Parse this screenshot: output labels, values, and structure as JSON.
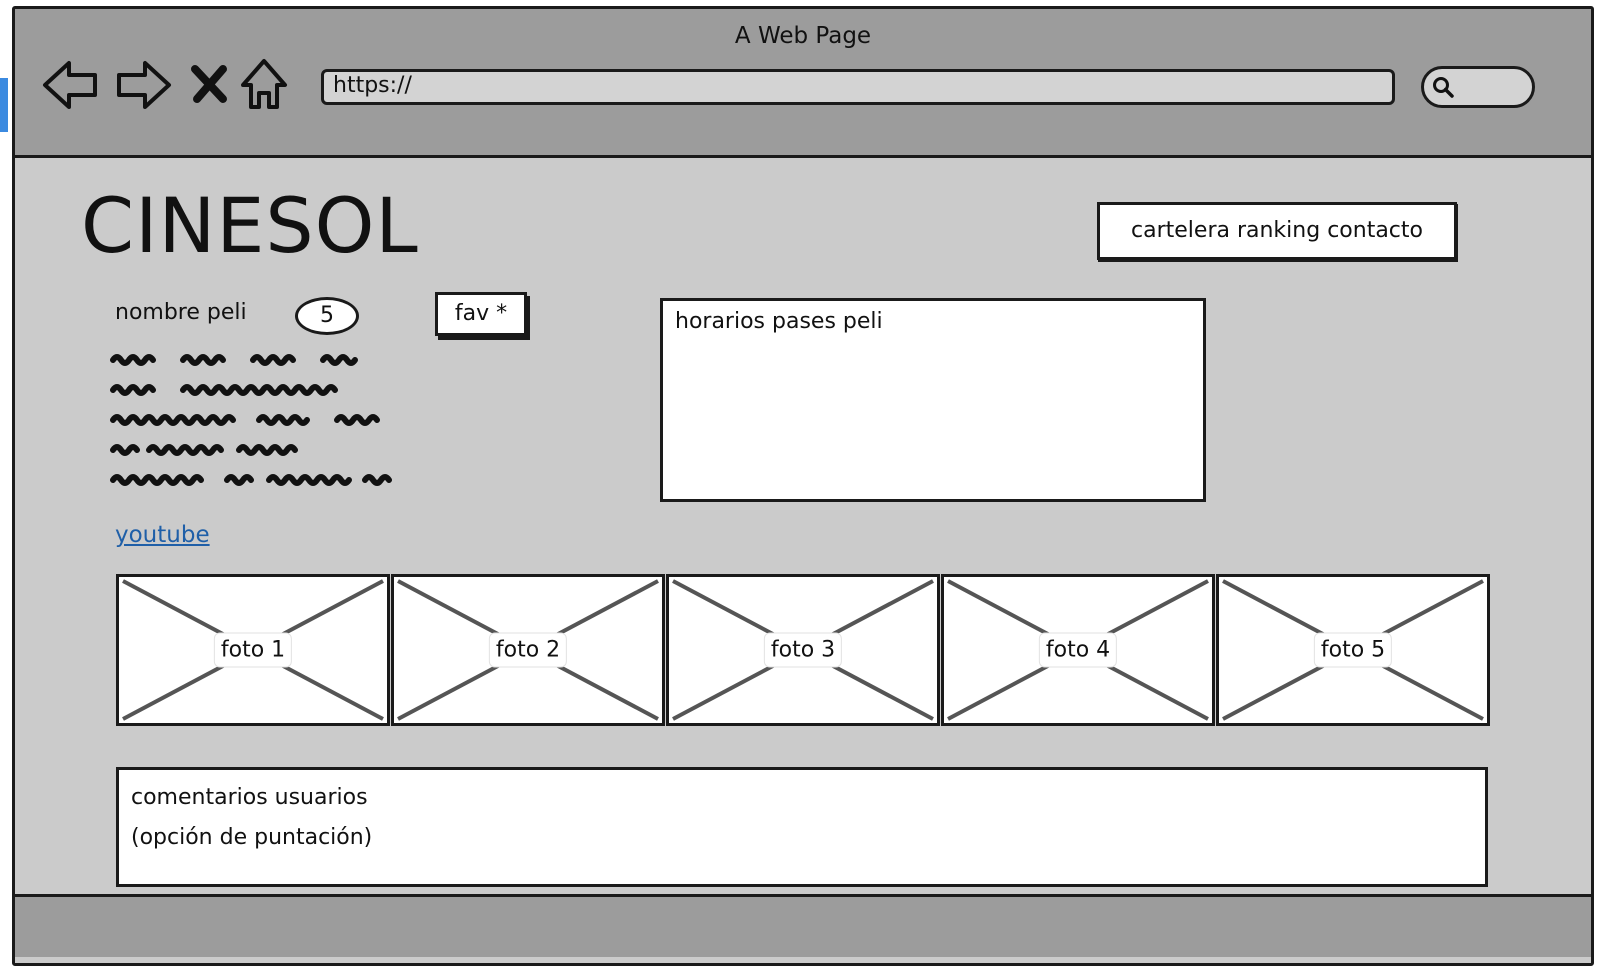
{
  "window": {
    "title": "A Web Page"
  },
  "browser": {
    "url": "https://",
    "icons": {
      "back": "arrow-left-icon",
      "forward": "arrow-right-icon",
      "stop": "close-icon",
      "home": "home-icon",
      "search": "search-icon"
    }
  },
  "site": {
    "logo": "CINESOL",
    "nav_menu": "cartelera ranking contacto"
  },
  "movie": {
    "name": "nombre peli",
    "rating": "5",
    "fav_label": "fav *",
    "trailer_link": "youtube",
    "schedule_title": "horarios pases peli"
  },
  "gallery": [
    {
      "caption": "foto 1"
    },
    {
      "caption": "foto 2"
    },
    {
      "caption": "foto 3"
    },
    {
      "caption": "foto 4"
    },
    {
      "caption": "foto 5"
    }
  ],
  "comments": {
    "line1": "comentarios usuarios",
    "line2": "(opción de puntación)"
  },
  "colors": {
    "chrome": "#9c9c9c",
    "page": "#cbcbcb",
    "link": "#1f5fa8",
    "ink": "#1a1a1a"
  }
}
